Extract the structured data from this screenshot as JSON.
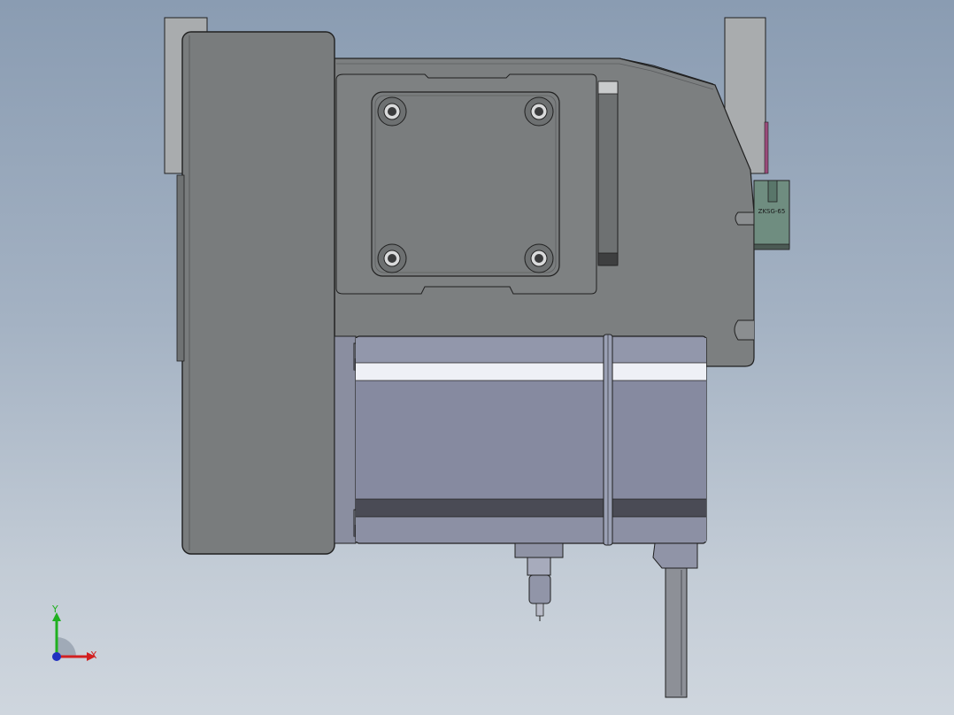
{
  "viewport": {
    "background_top": "#8a9cb2",
    "background_bottom": "#cfd6de"
  },
  "model": {
    "part_label": "ZKSG-65",
    "colors": {
      "housing": "#7c7f80",
      "housing_dark": "#6b6e70",
      "plate": "#8a8d90",
      "motor_body": "#8e92a6",
      "motor_highlight": "#eef0f6",
      "motor_band": "#4a4b55",
      "bracket": "#a9acae",
      "sensor": "#6f8d80",
      "cable": "#8d9097",
      "edge": "#202020"
    }
  },
  "triad": {
    "x_label": "X",
    "y_label": "Y",
    "x_color": "#d22020",
    "y_color": "#20b020",
    "z_color": "#2030c0"
  }
}
